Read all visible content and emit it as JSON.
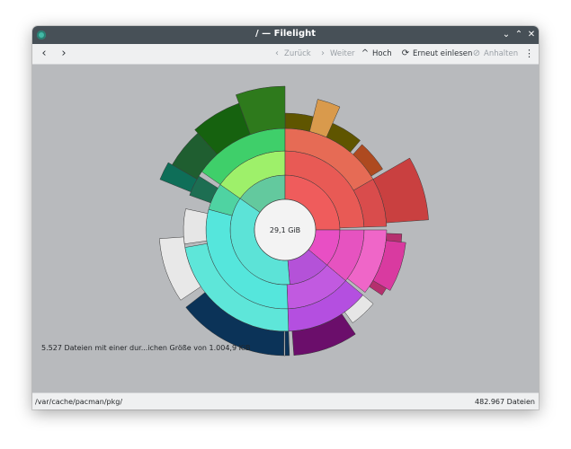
{
  "window": {
    "title": "/ — Filelight",
    "controls": {
      "minimize": "⌄",
      "maximize": "⌃",
      "close": "✕"
    }
  },
  "toolbar": {
    "back": "‹",
    "forward": "›",
    "zurueck": {
      "label": "Zurück",
      "icon": "chevron-left-icon"
    },
    "weiter": {
      "label": "Weiter",
      "icon": "chevron-right-icon"
    },
    "hoch": {
      "label": "Hoch",
      "icon": "chevron-up-icon"
    },
    "erneut": {
      "label": "Erneut einlesen",
      "icon": "refresh-icon"
    },
    "anhalten": {
      "label": "Anhalten",
      "icon": "stop-icon"
    },
    "menu": "⋮"
  },
  "map": {
    "center_label": "29,1 GiB",
    "info": "5.527 Dateien mit einer dur...ichen Größe von 1.004,9 KiB"
  },
  "statusbar": {
    "path": "/var/cache/pacman/pkg/",
    "file_count": "482.967 Dateien"
  },
  "colors": {
    "titlebar": "#475057",
    "canvas": "#b8babd",
    "cyan": "#5ce3d7",
    "red": "#ef5c5c",
    "green": "#9ef06a",
    "magenta": "#e84fc4",
    "purple": "#b452d8",
    "navy": "#0b3358",
    "olive": "#5f5500"
  }
}
